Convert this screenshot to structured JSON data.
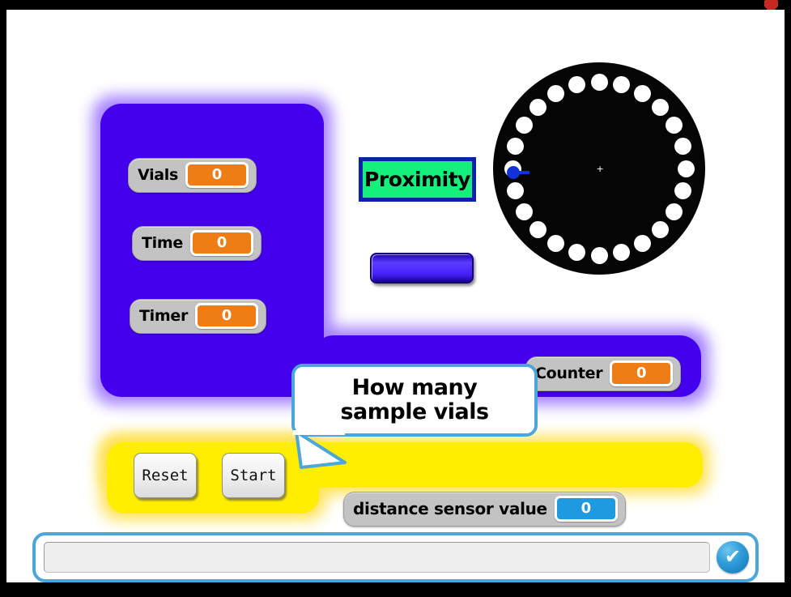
{
  "window": {
    "frame_color": "#000000",
    "stage_background": "#ffffff"
  },
  "top_bar": {
    "stop_icon": "stop-icon",
    "stop_color": "#c42a20"
  },
  "panels": {
    "purple": {
      "name": "control-panel",
      "color": "#4400ee",
      "glow_color": "#a07bff"
    },
    "yellow": {
      "name": "button-panel",
      "color": "#ffee00",
      "glow_color": "#ffe14d"
    }
  },
  "monitors": [
    {
      "id": "vials",
      "label": "Vials",
      "value": "0",
      "style": "orange"
    },
    {
      "id": "time",
      "label": "Time",
      "value": "0",
      "style": "orange"
    },
    {
      "id": "timer",
      "label": "Timer",
      "value": "0",
      "style": "orange"
    },
    {
      "id": "counter",
      "label": "Counter",
      "value": "0",
      "style": "orange"
    },
    {
      "id": "distance",
      "label": "distance sensor value",
      "value": "0",
      "style": "blue"
    }
  ],
  "sprites": {
    "proximity": {
      "label": "Proximity",
      "fill": "#15f07c",
      "border": "#0b21a8"
    },
    "blue_bar": {
      "label": "",
      "fill": "#4a22ff"
    },
    "carousel": {
      "label": "carousel-disk",
      "fill": "#050505",
      "hole_count": 24,
      "hole_color": "#ffffff",
      "center_mark": "+"
    },
    "robot": {
      "label": "robot-marker",
      "fill": "#1032d6"
    }
  },
  "buttons": [
    {
      "id": "reset",
      "label": "Reset"
    },
    {
      "id": "start",
      "label": "Start"
    }
  ],
  "speech": {
    "text": "How many sample vials",
    "border_color": "#4da6d9"
  },
  "ask_prompt": {
    "value": "",
    "placeholder": "",
    "submit_icon": "✔",
    "border_color": "#4da6d9"
  }
}
